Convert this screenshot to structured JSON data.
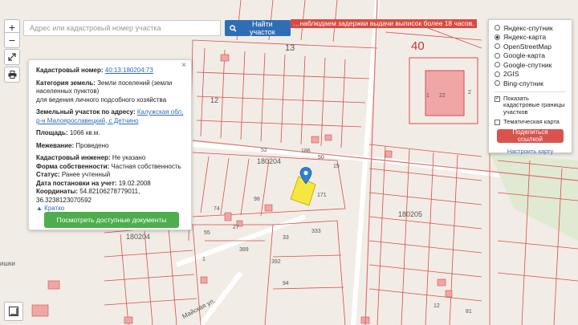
{
  "search": {
    "placeholder": "Адрес или кадастровый номер участка",
    "button_label": "Найти участок"
  },
  "banner": {
    "text": "…наблюдаем задержки выдачи выписок более 18 часов."
  },
  "controls": {
    "zoom_in": "+",
    "zoom_out": "−"
  },
  "parcel": {
    "cadastral_number_label": "Кадастровый номер:",
    "cadastral_number": "40:13:180204:73",
    "category_label": "Категория земель:",
    "category_value": "Земли поселений (земли населенных пунктов)",
    "category_sub": "для ведения личного подсобного хозяйства",
    "address_label": "Земельный участок по адресу:",
    "address_value": "Калужская обл, р-н Малоярославецкий, с Детчино",
    "area_label": "Площадь:",
    "area_value": "1066 кв.м.",
    "survey_label": "Межевание:",
    "survey_value": "Проведено",
    "engineer_label": "Кадастровый инженер:",
    "engineer_value": "Не указано",
    "ownership_label": "Форма собственности:",
    "ownership_value": "Частная собственность",
    "status_label": "Статус:",
    "status_value": "Ранее учтенный",
    "date_label": "Дата постановки на учет:",
    "date_value": "19.02.2008",
    "coords_label": "Координаты:",
    "coords_value": "54.8210627877901‪1, 36.3238123070592",
    "collapse_label": "Кратко",
    "docs_button": "Посмотреть доступные документы",
    "close": "×"
  },
  "layers": {
    "options": [
      {
        "label": "Яндекс-спутник",
        "selected": false
      },
      {
        "label": "Яндекс-карта",
        "selected": true
      },
      {
        "label": "OpenStreetMap",
        "selected": false
      },
      {
        "label": "Google-карта",
        "selected": false
      },
      {
        "label": "Google-спутник",
        "selected": false
      },
      {
        "label": "2GIS",
        "selected": false
      },
      {
        "label": "Bing-спутник",
        "selected": false
      }
    ],
    "show_borders_label": "Показать кадастровые границы участков",
    "show_borders_checked": true,
    "thematic_label": "Тематическая карта",
    "thematic_checked": false,
    "share_button": "Поделиться ссылкой",
    "configure_link": "Настроить карту"
  },
  "map_labels": {
    "block_40": "40",
    "block_13": "13",
    "block_12": "12",
    "block_180204_a": "180204",
    "block_180204_b": "180204",
    "block_180205": "180205",
    "street": "Майская ул.",
    "corner": "ишки",
    "building_labels": [
      "22",
      "1",
      "2",
      "52",
      "50",
      "186",
      "15",
      "171",
      "333",
      "33",
      "392",
      "94",
      "74",
      "98",
      "55",
      "389",
      "27",
      "12",
      "81",
      "1"
    ]
  },
  "colors": {
    "accent_blue": "#2f6eb5",
    "green": "#4cae4c",
    "red": "#d9534f",
    "cadastral_line": "#d94c4c",
    "highlight_parcel": "#f5e642"
  }
}
